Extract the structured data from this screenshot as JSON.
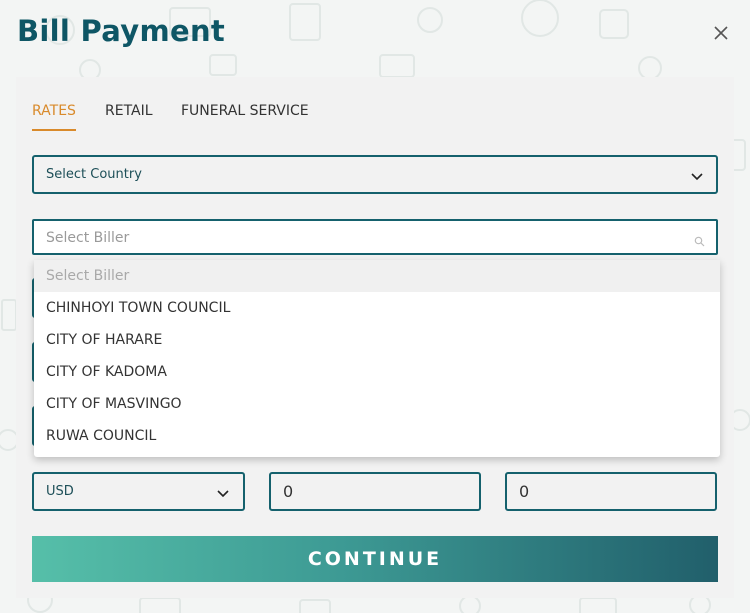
{
  "dialog": {
    "title": "Bill Payment"
  },
  "tabs": [
    {
      "label": "RATES",
      "active": true
    },
    {
      "label": "RETAIL",
      "active": false
    },
    {
      "label": "FUNERAL SERVICE",
      "active": false
    }
  ],
  "country_select": {
    "selected": "Select Country"
  },
  "biller_search": {
    "placeholder": "Select Biller",
    "value": ""
  },
  "biller_options": [
    "Select Biller",
    "CHINHOYI TOWN COUNCIL",
    "CITY OF HARARE",
    "CITY OF KADOMA",
    "CITY OF MASVINGO",
    "RUWA COUNCIL"
  ],
  "currency_select": {
    "selected": "USD"
  },
  "amount_field_1": {
    "value": "0"
  },
  "amount_field_2": {
    "value": "0"
  },
  "continue_button": {
    "label": "CONTINUE"
  },
  "colors": {
    "brand": "#0e5665",
    "accent": "#d98a2b",
    "border": "#15616d"
  },
  "icons": {
    "close": "close-icon",
    "chevron": "chevron-down-icon",
    "search": "search-icon"
  }
}
